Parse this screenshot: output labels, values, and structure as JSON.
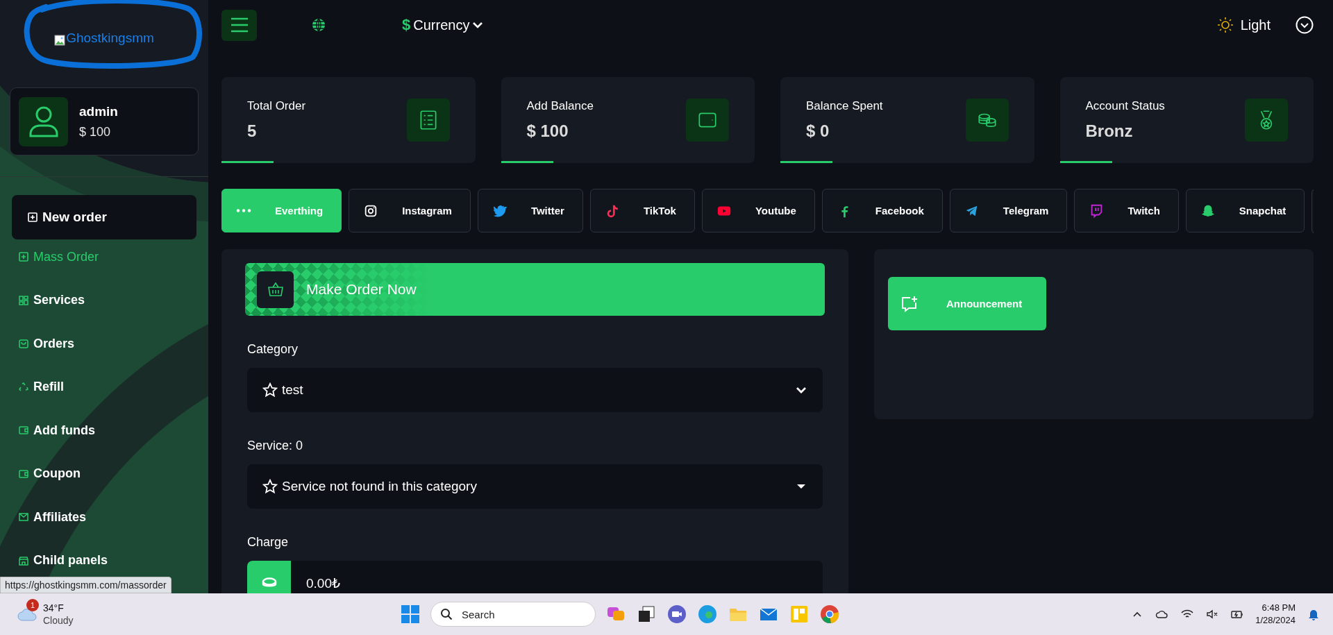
{
  "logo": {
    "alt_text": "Ghostkingsmm"
  },
  "user": {
    "name": "admin",
    "balance": "$ 100"
  },
  "sidebar": {
    "items": [
      {
        "label": "New order",
        "selected": true,
        "hovered": false
      },
      {
        "label": "Mass Order",
        "selected": false,
        "hovered": true
      },
      {
        "label": "Services",
        "selected": false,
        "hovered": false
      },
      {
        "label": "Orders",
        "selected": false,
        "hovered": false
      },
      {
        "label": "Refill",
        "selected": false,
        "hovered": false
      },
      {
        "label": "Add funds",
        "selected": false,
        "hovered": false
      },
      {
        "label": "Coupon",
        "selected": false,
        "hovered": false
      },
      {
        "label": "Affiliates",
        "selected": false,
        "hovered": false
      },
      {
        "label": "Child panels",
        "selected": false,
        "hovered": false
      }
    ]
  },
  "status_link": "https://ghostkingsmm.com/massorder",
  "topbar": {
    "currency_symbol": "$",
    "currency": "Currency",
    "theme": "Light"
  },
  "stats": [
    {
      "label": "Total Order",
      "value": "5"
    },
    {
      "label": "Add Balance",
      "value": "$ 100"
    },
    {
      "label": "Balance Spent",
      "value": "$ 0"
    },
    {
      "label": "Account Status",
      "value": "Bronz"
    }
  ],
  "tabs": [
    {
      "label": "Everthing",
      "selected": true
    },
    {
      "label": "Instagram",
      "selected": false
    },
    {
      "label": "Twitter",
      "selected": false
    },
    {
      "label": "TikTok",
      "selected": false
    },
    {
      "label": "Youtube",
      "selected": false
    },
    {
      "label": "Facebook",
      "selected": false
    },
    {
      "label": "Telegram",
      "selected": false
    },
    {
      "label": "Twitch",
      "selected": false
    },
    {
      "label": "Snapchat",
      "selected": false
    }
  ],
  "order_form": {
    "title": "Make Order Now",
    "category_label": "Category",
    "category_value": "test",
    "service_label": "Service: 0",
    "service_value": "Service not found in this category",
    "charge_label": "Charge",
    "charge_value": "0.00₺"
  },
  "announcement": {
    "button": "Announcement"
  },
  "taskbar": {
    "temperature": "34°F",
    "weather": "Cloudy",
    "weather_badge": "1",
    "search_placeholder": "Search",
    "time": "6:48 PM",
    "date": "1/28/2024"
  }
}
